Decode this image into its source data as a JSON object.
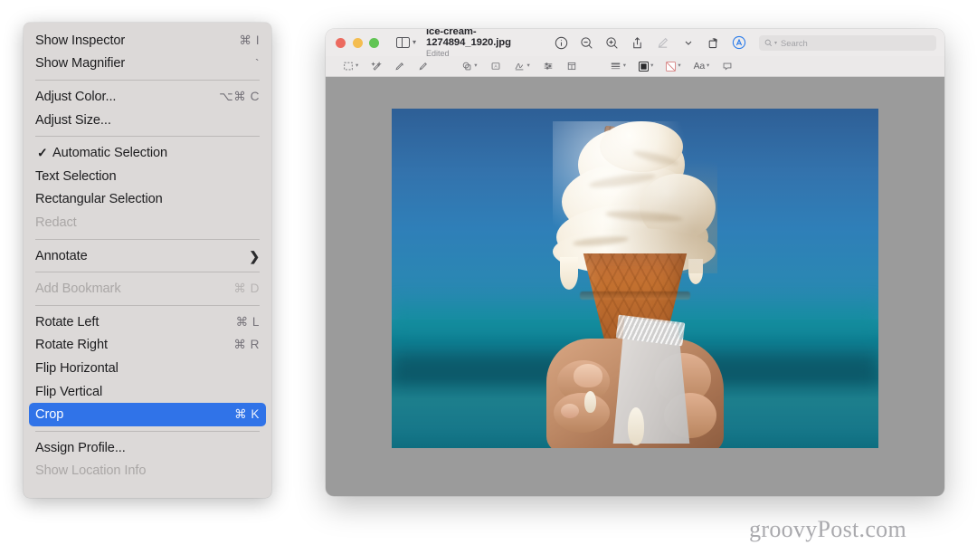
{
  "context_menu": {
    "items": [
      {
        "label": "Show Inspector",
        "shortcut": "⌘ I",
        "state": "normal",
        "type": "item"
      },
      {
        "label": "Show Magnifier",
        "shortcut": "`",
        "state": "normal",
        "type": "item"
      },
      {
        "type": "separator"
      },
      {
        "label": "Adjust Color...",
        "shortcut": "⌥⌘ C",
        "state": "normal",
        "type": "item"
      },
      {
        "label": "Adjust Size...",
        "shortcut": "",
        "state": "normal",
        "type": "item"
      },
      {
        "type": "separator"
      },
      {
        "label": "Automatic Selection",
        "shortcut": "",
        "state": "checked",
        "type": "item"
      },
      {
        "label": "Text Selection",
        "shortcut": "",
        "state": "normal",
        "type": "item"
      },
      {
        "label": "Rectangular Selection",
        "shortcut": "",
        "state": "normal",
        "type": "item"
      },
      {
        "label": "Redact",
        "shortcut": "",
        "state": "disabled",
        "type": "item"
      },
      {
        "type": "separator"
      },
      {
        "label": "Annotate",
        "shortcut": "",
        "state": "submenu",
        "type": "item"
      },
      {
        "type": "separator"
      },
      {
        "label": "Add Bookmark",
        "shortcut": "⌘ D",
        "state": "disabled",
        "type": "item"
      },
      {
        "type": "separator"
      },
      {
        "label": "Rotate Left",
        "shortcut": "⌘ L",
        "state": "normal",
        "type": "item"
      },
      {
        "label": "Rotate Right",
        "shortcut": "⌘ R",
        "state": "normal",
        "type": "item"
      },
      {
        "label": "Flip Horizontal",
        "shortcut": "",
        "state": "normal",
        "type": "item"
      },
      {
        "label": "Flip Vertical",
        "shortcut": "",
        "state": "normal",
        "type": "item"
      },
      {
        "label": "Crop",
        "shortcut": "⌘ K",
        "state": "selected",
        "type": "item"
      },
      {
        "type": "separator"
      },
      {
        "label": "Assign Profile...",
        "shortcut": "",
        "state": "normal",
        "type": "item"
      },
      {
        "label": "Show Location Info",
        "shortcut": "",
        "state": "disabled",
        "type": "item"
      }
    ],
    "checkmark_glyph": "✓",
    "submenu_glyph": "❯",
    "highlight_color": "#3073e8",
    "background_color": "#dcd9d8"
  },
  "window": {
    "traffic_lights": {
      "close": "close-button",
      "minimize": "minimize-button",
      "maximize": "maximize-button"
    },
    "sidebar_toggle": "sidebar-toggle-button",
    "document_title": "ice-cream-1274894_1920.jpg",
    "document_status": "Edited",
    "toolbar_right": [
      {
        "name": "info-icon",
        "state": "normal"
      },
      {
        "name": "zoom-out-icon",
        "state": "normal"
      },
      {
        "name": "zoom-in-icon",
        "state": "normal"
      },
      {
        "name": "share-icon",
        "state": "normal"
      },
      {
        "name": "markup-pen-icon",
        "state": "dimmed"
      },
      {
        "name": "chevron-down-icon",
        "state": "normal"
      },
      {
        "name": "rotate-icon",
        "state": "normal"
      },
      {
        "name": "annotate-a-icon",
        "state": "active"
      }
    ],
    "search": {
      "placeholder": "Search",
      "value": ""
    },
    "markup_toolbar": [
      {
        "name": "selection-tool-icon",
        "has_chevron": true
      },
      {
        "name": "instant-alpha-icon",
        "has_chevron": false
      },
      {
        "name": "sketch-icon",
        "has_chevron": false
      },
      {
        "name": "draw-icon",
        "has_chevron": false
      },
      {
        "name": "shapes-icon",
        "has_chevron": true
      },
      {
        "name": "text-box-icon",
        "has_chevron": false
      },
      {
        "name": "sign-icon",
        "has_chevron": true
      },
      {
        "name": "adjust-icon",
        "has_chevron": false
      },
      {
        "name": "crop-icon",
        "has_chevron": false
      },
      {
        "name": "shape-style-icon",
        "has_chevron": true
      },
      {
        "name": "fill-color-icon",
        "has_chevron": true
      },
      {
        "name": "border-color-icon",
        "has_chevron": true
      },
      {
        "name": "text-style-icon",
        "label": "Aa",
        "has_chevron": true
      },
      {
        "name": "note-icon",
        "has_chevron": false
      }
    ],
    "canvas_color": "#9b9b9b",
    "image_alt": "Ice cream cone with chocolate flake held in a hand at the beach"
  },
  "watermark": {
    "text": "groovyPost.com"
  }
}
